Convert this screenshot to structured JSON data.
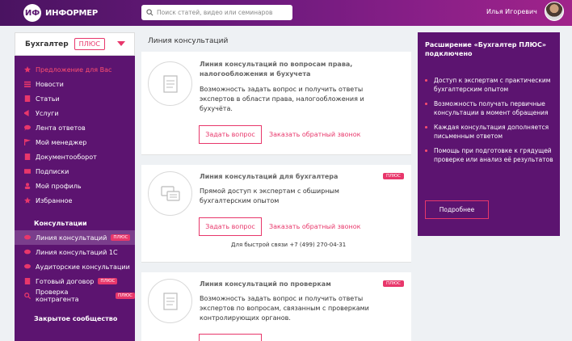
{
  "header": {
    "logo_text": "ИНФОРМЕР",
    "search_placeholder": "Поиск статей, видео или семинаров",
    "user_name": "Илья Игоревич"
  },
  "sidebar": {
    "title": "Бухгалтер",
    "badge": "ПЛЮС",
    "items": [
      {
        "label": "Предложение для Вас",
        "icon": "star-icon"
      },
      {
        "label": "Новости",
        "icon": "list-icon"
      },
      {
        "label": "Статьи",
        "icon": "document-icon"
      },
      {
        "label": "Услуги",
        "icon": "megaphone-icon"
      },
      {
        "label": "Лента ответов",
        "icon": "chat-icon"
      },
      {
        "label": "Мой менеджер",
        "icon": "flag-icon"
      },
      {
        "label": "Документооборот",
        "icon": "document-icon"
      },
      {
        "label": "Подписки",
        "icon": "envelope-icon"
      },
      {
        "label": "Мой профиль",
        "icon": "user-icon"
      },
      {
        "label": "Избранное",
        "icon": "star-icon"
      }
    ],
    "section1": "Консультации",
    "consult_items": [
      {
        "label": "Линия консультаций",
        "badge": "ПЛЮС"
      },
      {
        "label": "Линия консультаций 1С",
        "badge": ""
      },
      {
        "label": "Аудиторские консультации",
        "badge": ""
      },
      {
        "label": "Готовый договор",
        "badge": "ПЛЮС"
      },
      {
        "label": "Проверка контрагента",
        "badge": "ПЛЮС"
      }
    ],
    "section2": "Закрытое сообщество"
  },
  "main": {
    "title": "Линия консультаций",
    "cards": [
      {
        "title": "Линия консультаций по вопросам права, налогообложения и бухучета",
        "desc": "Возможность задать вопрос и получить ответы экспертов в области права, налогообложения и бухучёта.",
        "button": "Задать вопрос",
        "link": "Заказать обратный звонок",
        "badge": ""
      },
      {
        "title": "Линия консультаций для бухгалтера",
        "desc": "Прямой доступ к экспертам с обширным бухгалтерским опытом",
        "button": "Задать вопрос",
        "link": "Заказать обратный звонок",
        "badge": "ПЛЮС",
        "note": "Для быстрой связи +7 (499) 270-04-31"
      },
      {
        "title": "Линия консультаций по проверкам",
        "desc": "Возможность задать вопрос и получить ответы экспертов по вопросам, связанным с проверками контролирующих органов.",
        "badge": "ПЛЮС"
      }
    ]
  },
  "promo": {
    "title": "Расширение «Бухгалтер ПЛЮС» подключено",
    "items": [
      "Доступ к экспертам с практическим бухгалтерским опытом",
      "Возможность получать первичные консультации в момент обращения",
      "Каждая консультация дополняется письменным ответом",
      "Помощь при подготовке к грядущей проверке или анализ её результатов"
    ],
    "button": "Подробнее"
  },
  "colors": {
    "accent": "#e8376b",
    "sidebar": "#5c1470"
  }
}
